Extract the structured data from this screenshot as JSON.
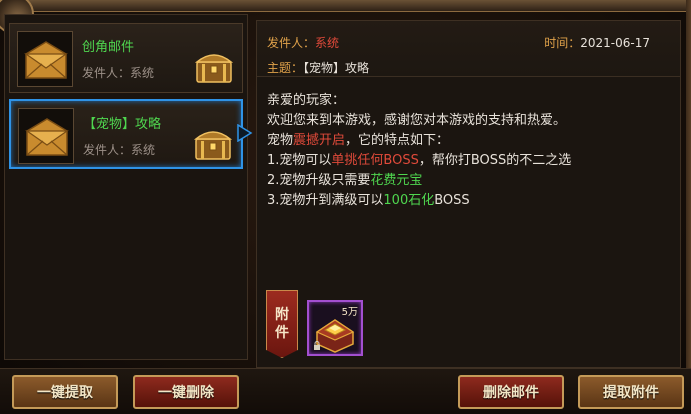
{
  "mail_list": [
    {
      "title": "创角邮件",
      "sender_label": "发件人：",
      "sender": "系统",
      "selected": false
    },
    {
      "title": "【宠物】攻略",
      "sender_label": "发件人：",
      "sender": "系统",
      "selected": true
    }
  ],
  "detail": {
    "sender_label": "发件人：",
    "sender": "系统",
    "time_label": "时间：",
    "time": "2021-06-17",
    "subject_label": "主题：",
    "subject": "【宠物】攻略",
    "body": {
      "greeting": "亲爱的玩家：",
      "line1": "欢迎您来到本游戏，感谢您对本游戏的支持和热爱。",
      "line2_a": "宠物",
      "line2_hl": "震撼开启",
      "line2_b": "，它的特点如下：",
      "line3_a": "1.宠物可以",
      "line3_hl": "单挑任何BOSS",
      "line3_b": "，帮你打BOSS的不二之选",
      "line4_a": "2.宠物升级只需要",
      "line4_hl": "花费元宝",
      "line5_a": "3.宠物升到满级可以",
      "line5_hl": "100石化",
      "line5_b": "BOSS"
    }
  },
  "attachment": {
    "tag_char1": "附",
    "tag_char2": "件",
    "item_count": "5万",
    "item_icon": "gold-ingot-icon"
  },
  "buttons": {
    "collect_all": "一键提取",
    "delete_all": "一键删除",
    "delete_mail": "删除邮件",
    "collect_attachment": "提取附件"
  },
  "colors": {
    "selected_border": "#2f93e6",
    "title_green": "#4fd64f",
    "label_orange": "#e0a24a",
    "highlight_red": "#e04a3a"
  }
}
